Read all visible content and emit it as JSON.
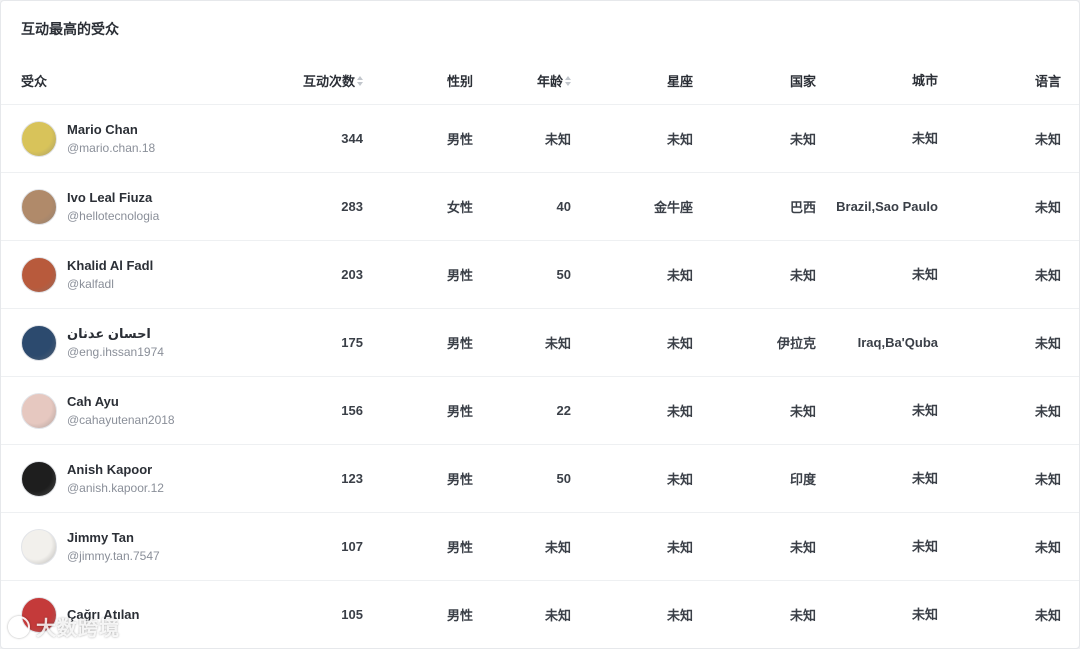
{
  "title": "互动最高的受众",
  "columns": {
    "audience": "受众",
    "interactions": "互动次数",
    "gender": "性别",
    "age": "年龄",
    "zodiac": "星座",
    "country": "国家",
    "city": "城市",
    "language": "语言"
  },
  "rows": [
    {
      "name": "Mario Chan",
      "handle": "@mario.chan.18",
      "interactions": "344",
      "gender": "男性",
      "age": "未知",
      "zodiac": "未知",
      "country": "未知",
      "city": "未知",
      "language": "未知"
    },
    {
      "name": "Ivo Leal Fiuza",
      "handle": "@hellotecnologia",
      "interactions": "283",
      "gender": "女性",
      "age": "40",
      "zodiac": "金牛座",
      "country": "巴西",
      "city": "Brazil,Sao Paulo",
      "language": "未知"
    },
    {
      "name": "Khalid Al Fadl",
      "handle": "@kalfadl",
      "interactions": "203",
      "gender": "男性",
      "age": "50",
      "zodiac": "未知",
      "country": "未知",
      "city": "未知",
      "language": "未知"
    },
    {
      "name": "احسان عدنان",
      "handle": "@eng.ihssan1974",
      "interactions": "175",
      "gender": "男性",
      "age": "未知",
      "zodiac": "未知",
      "country": "伊拉克",
      "city": "Iraq,Ba'Quba",
      "language": "未知"
    },
    {
      "name": "Cah Ayu",
      "handle": "@cahayutenan2018",
      "interactions": "156",
      "gender": "男性",
      "age": "22",
      "zodiac": "未知",
      "country": "未知",
      "city": "未知",
      "language": "未知"
    },
    {
      "name": "Anish Kapoor",
      "handle": "@anish.kapoor.12",
      "interactions": "123",
      "gender": "男性",
      "age": "50",
      "zodiac": "未知",
      "country": "印度",
      "city": "未知",
      "language": "未知"
    },
    {
      "name": "Jimmy Tan",
      "handle": "@jimmy.tan.7547",
      "interactions": "107",
      "gender": "男性",
      "age": "未知",
      "zodiac": "未知",
      "country": "未知",
      "city": "未知",
      "language": "未知"
    },
    {
      "name": "Çağrı Atılan",
      "handle": "",
      "interactions": "105",
      "gender": "男性",
      "age": "未知",
      "zodiac": "未知",
      "country": "未知",
      "city": "未知",
      "language": "未知"
    }
  ],
  "avatar_colors": [
    "#d8c35a",
    "#b08a6a",
    "#b85a3c",
    "#2c4a6e",
    "#e6c8c0",
    "#1e1e1e",
    "#f2f0ec",
    "#c43a3a"
  ],
  "watermark": "大数跨境"
}
